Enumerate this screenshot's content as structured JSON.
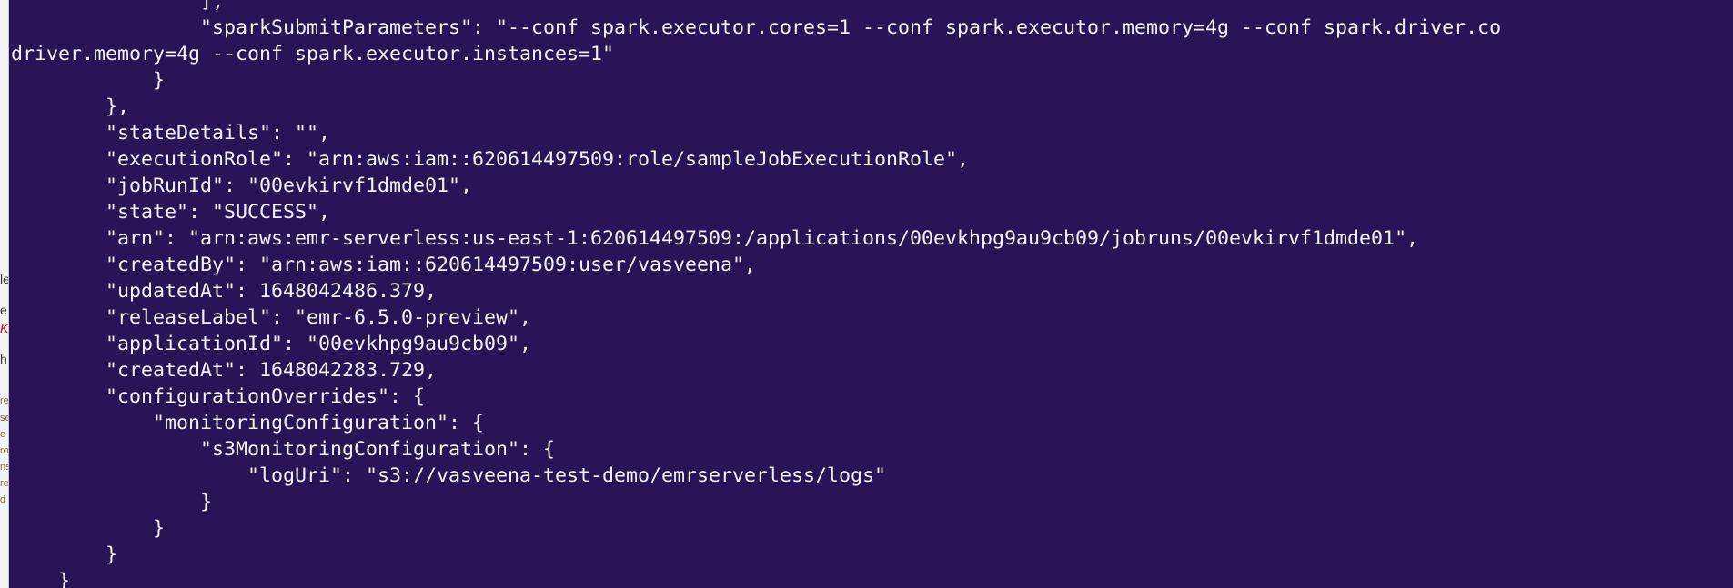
{
  "terminal": {
    "lines": [
      "                ],",
      "                \"sparkSubmitParameters\": \"--conf spark.executor.cores=1 --conf spark.executor.memory=4g --conf spark.driver.co",
      "driver.memory=4g --conf spark.executor.instances=1\"",
      "            }",
      "        },",
      "        \"stateDetails\": \"\",",
      "        \"executionRole\": \"arn:aws:iam::620614497509:role/sampleJobExecutionRole\",",
      "        \"jobRunId\": \"00evkirvf1dmde01\",",
      "        \"state\": \"SUCCESS\",",
      "        \"arn\": \"arn:aws:emr-serverless:us-east-1:620614497509:/applications/00evkhpg9au9cb09/jobruns/00evkirvf1dmde01\",",
      "        \"createdBy\": \"arn:aws:iam::620614497509:user/vasveena\",",
      "        \"updatedAt\": 1648042486.379,",
      "        \"releaseLabel\": \"emr-6.5.0-preview\",",
      "        \"applicationId\": \"00evkhpg9au9cb09\",",
      "        \"createdAt\": 1648042283.729,",
      "        \"configurationOverrides\": {",
      "            \"monitoringConfiguration\": {",
      "                \"s3MonitoringConfiguration\": {",
      "                    \"logUri\": \"s3://vasveena-test-demo/emrserverless/logs\"",
      "                }",
      "            }",
      "        }",
      "    }"
    ]
  },
  "left_window": {
    "fragments": [
      "le",
      "e",
      "K",
      "h",
      "re",
      "se",
      "e",
      "ro",
      "ns",
      "re",
      "d"
    ]
  },
  "colors": {
    "terminal_background": "#2a1458",
    "terminal_text": "#f2f2f2",
    "left_window_background": "#f3f3f3"
  }
}
